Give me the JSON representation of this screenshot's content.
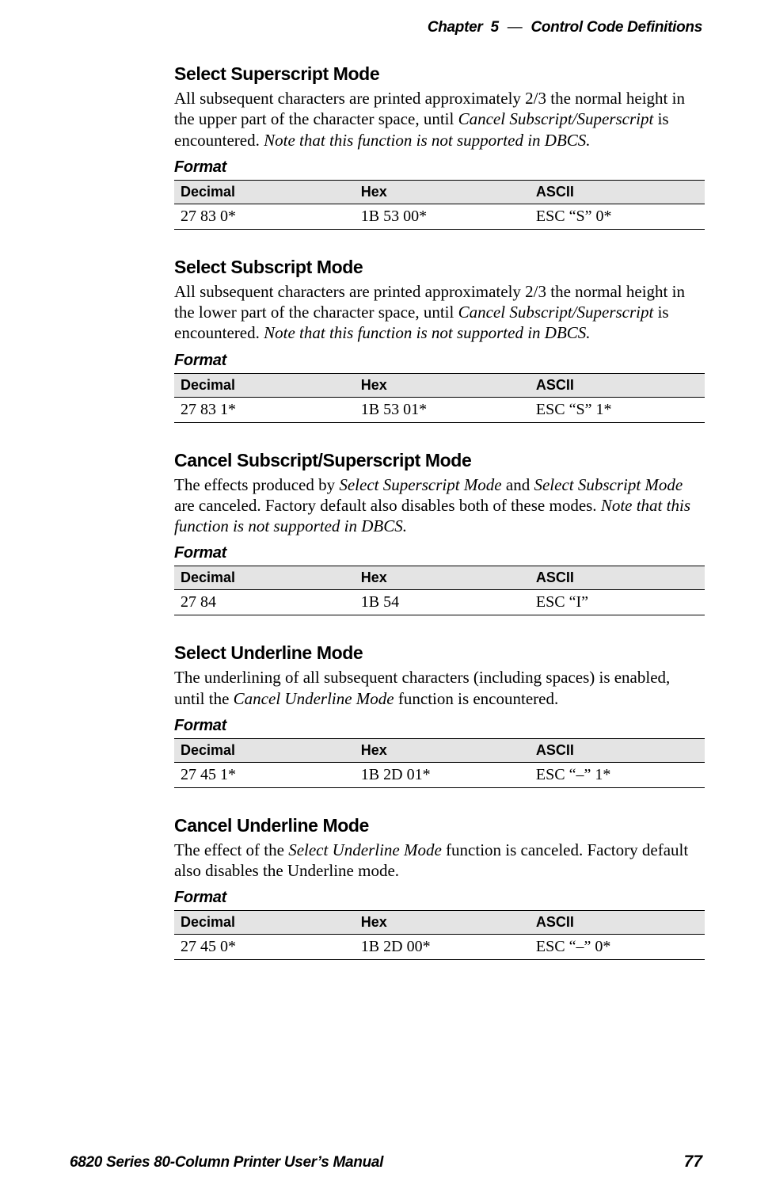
{
  "header": {
    "chapter_word": "Chapter",
    "chapter_num": "5",
    "dash": "—",
    "title": "Control Code Definitions"
  },
  "format_label": "Format",
  "table_headers": {
    "decimal": "Decimal",
    "hex": "Hex",
    "ascii": "ASCII"
  },
  "sections": [
    {
      "title": "Select Superscript Mode",
      "body_pre": "All subsequent characters are printed approximately 2/3 the normal height in the upper part of the character space, until ",
      "body_ital1": "Cancel Subscript/Superscript",
      "body_mid": " is encountered. ",
      "body_ital2": "Note that this function is not supported in DBCS.",
      "body_post": "",
      "row": {
        "decimal": "27 83 0*",
        "hex": "1B 53 00*",
        "ascii": "ESC “S” 0*"
      }
    },
    {
      "title": "Select Subscript Mode",
      "body_pre": "All subsequent characters are printed approximately 2/3 the normal height in the lower part of the character space, until ",
      "body_ital1": "Cancel Subscript/Superscript",
      "body_mid": " is encountered. ",
      "body_ital2": "Note that this function is not supported in DBCS.",
      "body_post": "",
      "row": {
        "decimal": "27 83 1*",
        "hex": "1B 53 01*",
        "ascii": "ESC “S” 1*"
      }
    },
    {
      "title": "Cancel Subscript/Superscript Mode",
      "body_pre": "The effects produced by ",
      "body_ital1": "Select Superscript Mode",
      "body_mid": " and ",
      "body_ital2": "Select Subscript Mode",
      "body_post_pre": " are canceled. Factory default also disables both of these modes. ",
      "body_ital3": "Note that this function is not supported in DBCS.",
      "body_post": "",
      "row": {
        "decimal": "27 84",
        "hex": "1B 54",
        "ascii": "ESC “I”"
      }
    },
    {
      "title": "Select Underline Mode",
      "body_pre": "The underlining of all subsequent characters (including spaces) is enabled, until the ",
      "body_ital1": "Cancel Underline Mode",
      "body_mid": " function is encountered.",
      "body_ital2": "",
      "body_post": "",
      "row": {
        "decimal": "27 45 1*",
        "hex": "1B 2D 01*",
        "ascii": "ESC “–” 1*"
      }
    },
    {
      "title": "Cancel Underline Mode",
      "body_pre": "The effect of the ",
      "body_ital1": "Select Underline Mode",
      "body_mid": " function is canceled. Factory default also disables the Underline mode.",
      "body_ital2": "",
      "body_post": "",
      "row": {
        "decimal": "27 45 0*",
        "hex": "1B 2D 00*",
        "ascii": "ESC “–” 0*"
      }
    }
  ],
  "footer": {
    "manual": "6820 Series 80-Column Printer User’s Manual",
    "page": "77"
  }
}
